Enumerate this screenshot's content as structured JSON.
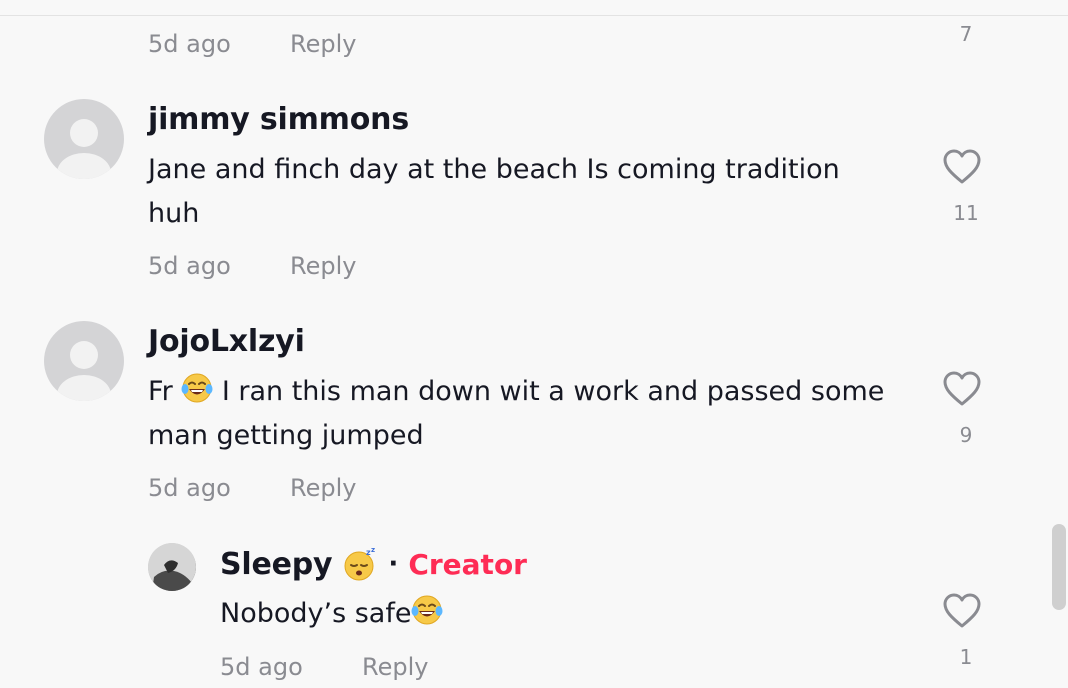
{
  "comments": [
    {
      "time": "5d ago",
      "reply_label": "Reply",
      "likes": "7"
    },
    {
      "username": "jimmy simmons",
      "text": "Jane and finch day at the beach Is coming tradition huh",
      "time": "5d ago",
      "reply_label": "Reply",
      "likes": "11"
    },
    {
      "username": "JojoLxlzyi",
      "text_before": "Fr ",
      "text_after": " I ran this man down wit a work and passed some man getting jumped",
      "time": "5d ago",
      "reply_label": "Reply",
      "likes": "9"
    }
  ],
  "reply": {
    "username": "Sleepy",
    "separator": "·",
    "creator_label": "Creator",
    "text": "Nobody’s safe",
    "time": "5d ago",
    "reply_label": "Reply",
    "likes": "1"
  },
  "icons": {
    "like": "heart-outline-icon",
    "default_avatar": "default-avatar-icon",
    "laughing_emoji": "tears-of-joy-emoji",
    "sleepy_emoji": "sleeping-face-emoji"
  },
  "colors": {
    "background": "#f8f8f8",
    "text": "#161823",
    "secondary": "#8a8b91",
    "creator": "#fe2c55"
  }
}
